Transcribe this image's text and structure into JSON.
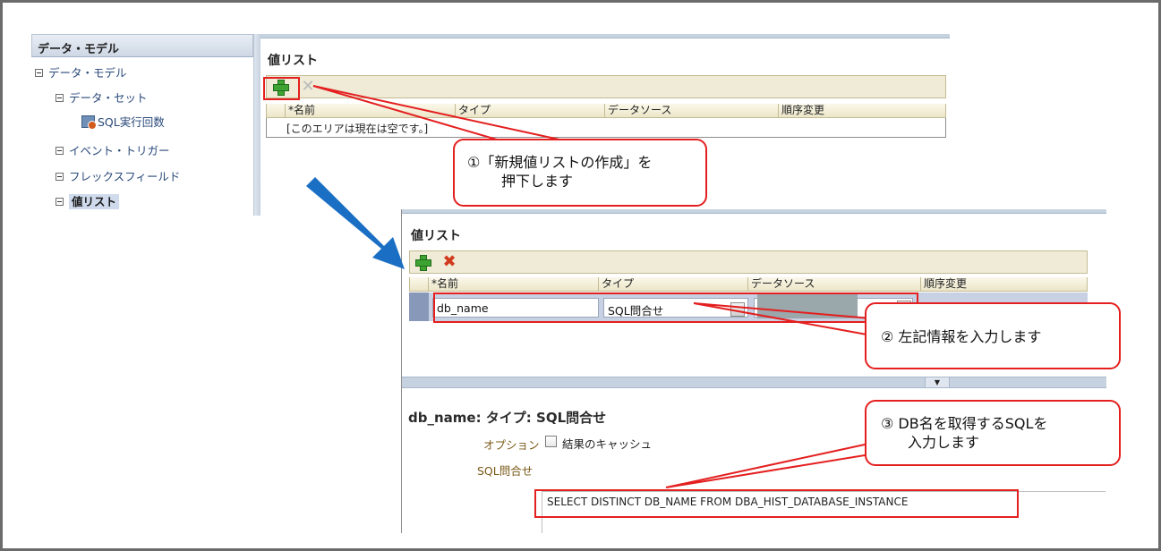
{
  "tree": {
    "header": "データ・モデル",
    "root": "データ・モデル",
    "dataset": "データ・セット",
    "dataset_child": "SQL実行回数",
    "event_trigger": "イベント・トリガー",
    "flexfield": "フレックスフィールド",
    "lov": "値リスト"
  },
  "top_panel": {
    "title": "値リスト",
    "add_icon": "plus-icon",
    "delete_icon": "x-icon",
    "columns": [
      "*名前",
      "タイプ",
      "データソース",
      "順序変更"
    ],
    "empty_text": "[このエリアは現在は空です。]"
  },
  "low_panel": {
    "title": "値リスト",
    "columns": [
      "*名前",
      "タイプ",
      "データソース",
      "順序変更"
    ],
    "row": {
      "name": "db_name",
      "type": "SQL問合せ",
      "datasource": ""
    },
    "detail_title": "db_name: タイプ: SQL問合せ",
    "option_label": "オプション",
    "cache_label": "結果のキャッシュ",
    "cache_checked": false,
    "sql_label": "SQL問合せ",
    "sql_text": "SELECT DISTINCT DB_NAME FROM DBA_HIST_DATABASE_INSTANCE"
  },
  "callouts": {
    "step1_line1": "①「新規値リストの作成」を",
    "step1_line2": "押下します",
    "step2": "② 左記情報を入力します",
    "step3_line1": "③ DB名を取得するSQLを",
    "step3_line2": "入力します"
  },
  "colors": {
    "annotation_red": "#e41f1f",
    "arrow_blue": "#1a6fc4",
    "add_green": "#3fa333",
    "delete_red": "#d23a1e"
  }
}
